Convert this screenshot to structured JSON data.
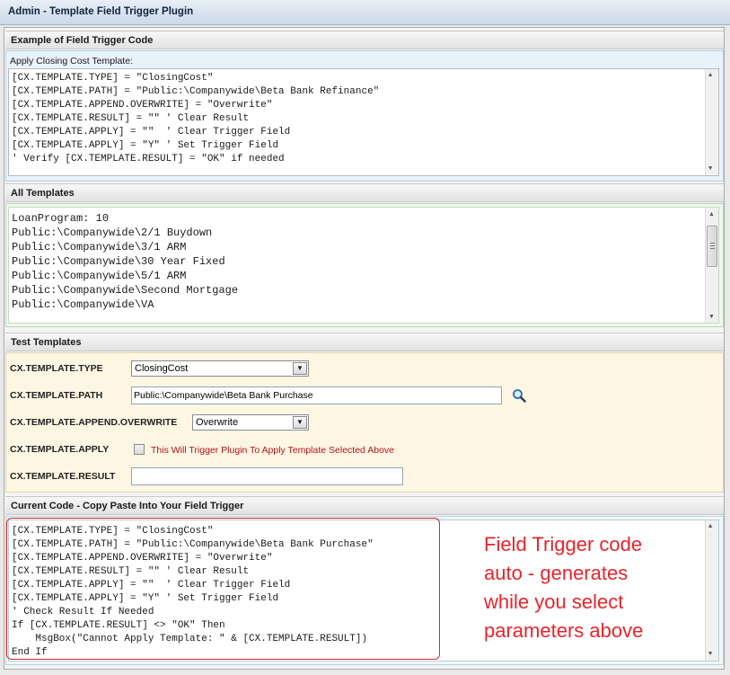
{
  "window": {
    "title": "Admin - Template Field Trigger Plugin"
  },
  "example": {
    "heading": "Example of Field Trigger Code",
    "sublabel": "Apply Closing Cost Template:",
    "code": "[CX.TEMPLATE.TYPE] = \"ClosingCost\"\n[CX.TEMPLATE.PATH] = \"Public:\\Companywide\\Beta Bank Refinance\"\n[CX.TEMPLATE.APPEND.OVERWRITE] = \"Overwrite\"\n[CX.TEMPLATE.RESULT] = \"\" ' Clear Result\n[CX.TEMPLATE.APPLY] = \"\"  ' Clear Trigger Field\n[CX.TEMPLATE.APPLY] = \"Y\" ' Set Trigger Field\n' Verify [CX.TEMPLATE.RESULT] = \"OK\" if needed"
  },
  "all_templates": {
    "heading": "All Templates",
    "content": "LoanProgram: 10\nPublic:\\Companywide\\2/1 Buydown\nPublic:\\Companywide\\3/1 ARM\nPublic:\\Companywide\\30 Year Fixed\nPublic:\\Companywide\\5/1 ARM\nPublic:\\Companywide\\Second Mortgage\nPublic:\\Companywide\\VA"
  },
  "test": {
    "heading": "Test Templates",
    "type_label": "CX.TEMPLATE.TYPE",
    "type_value": "ClosingCost",
    "path_label": "CX.TEMPLATE.PATH",
    "path_value": "Public:\\Companywide\\Beta Bank Purchase",
    "append_label": "CX.TEMPLATE.APPEND.OVERWRITE",
    "append_value": "Overwrite",
    "apply_label": "CX.TEMPLATE.APPLY",
    "apply_text": "This Will Trigger Plugin To Apply Template Selected Above",
    "result_label": "CX.TEMPLATE.RESULT",
    "result_value": ""
  },
  "current": {
    "heading": "Current Code - Copy Paste Into Your Field Trigger",
    "code": "[CX.TEMPLATE.TYPE] = \"ClosingCost\"\n[CX.TEMPLATE.PATH] = \"Public:\\Companywide\\Beta Bank Purchase\"\n[CX.TEMPLATE.APPEND.OVERWRITE] = \"Overwrite\"\n[CX.TEMPLATE.RESULT] = \"\" ' Clear Result\n[CX.TEMPLATE.APPLY] = \"\"  ' Clear Trigger Field\n[CX.TEMPLATE.APPLY] = \"Y\" ' Set Trigger Field\n' Check Result If Needed\nIf [CX.TEMPLATE.RESULT] <> \"OK\" Then\n    MsgBox(\"Cannot Apply Template: \" & [CX.TEMPLATE.RESULT])\nEnd If",
    "annotation": "Field Trigger code\nauto - generates\nwhile you select\nparameters above"
  },
  "colors": {
    "annotation": "#e8242b",
    "apply_text": "#b0121b",
    "test_bg": "#fdf6e3",
    "example_bg": "#e9f2fb",
    "current_bg": "#eef7fa"
  },
  "icons": {
    "search": "magnifier-icon",
    "dropdown": "chevron-down-icon"
  }
}
